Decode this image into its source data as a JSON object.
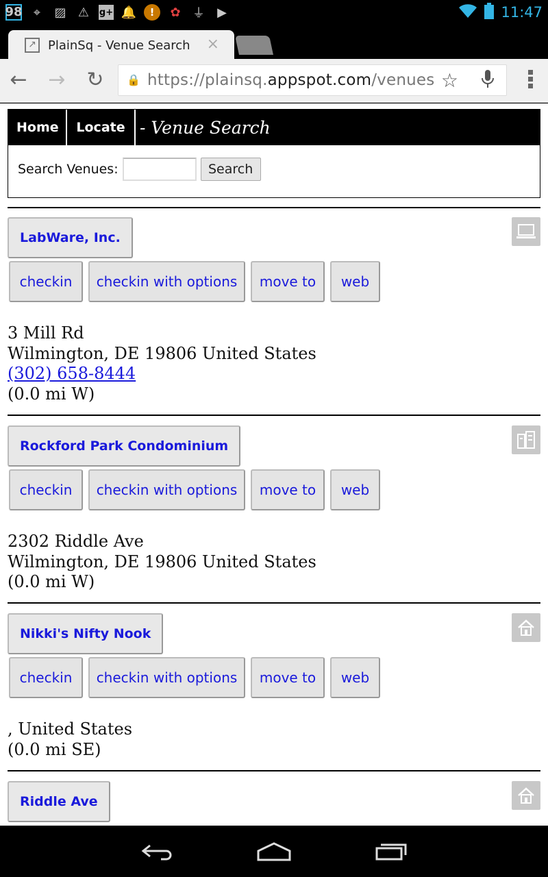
{
  "status_bar": {
    "notification_count": "98",
    "clock": "11:47",
    "icons": [
      "gps-icon",
      "image-icon",
      "warning-icon",
      "google-plus-icon",
      "bell-icon",
      "alert-icon",
      "pinwheel-icon",
      "usb-icon",
      "play-store-icon",
      "wifi-icon",
      "battery-icon"
    ]
  },
  "browser": {
    "tab_title": "PlainSq - Venue Search",
    "tab_close": "×",
    "url_prefix": "https://plainsq.",
    "url_host": "appspot.com",
    "url_path": "/venues"
  },
  "site": {
    "nav": {
      "home": "Home",
      "locate": "Locate"
    },
    "heading": "- Venue Search",
    "search": {
      "label": "Search Venues:",
      "value": "",
      "button": "Search"
    }
  },
  "actions": {
    "checkin": "checkin",
    "options": "checkin with options",
    "move": "move to",
    "web": "web"
  },
  "venues": [
    {
      "name": "LabWare, Inc.",
      "category_icon": "computer-icon",
      "address_line1": "3 Mill Rd",
      "address_line2": "Wilmington, DE 19806 United States",
      "phone": "(302) 658-8444",
      "distance": "(0.0 mi W)"
    },
    {
      "name": "Rockford Park Condominium",
      "category_icon": "building-icon",
      "address_line1": "2302 Riddle Ave",
      "address_line2": "Wilmington, DE 19806 United States",
      "distance": "(0.0 mi W)"
    },
    {
      "name": "Nikki's Nifty Nook",
      "category_icon": "home-icon",
      "address_line1": ", United States",
      "distance": "(0.0 mi SE)"
    },
    {
      "name": "Riddle Ave",
      "category_icon": "home-icon"
    }
  ]
}
